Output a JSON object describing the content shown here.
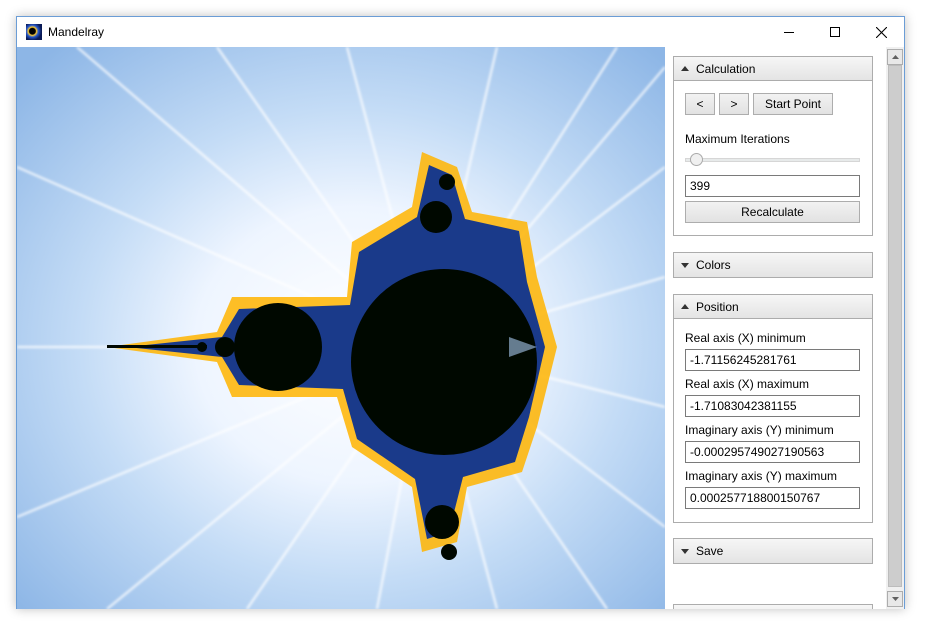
{
  "window": {
    "title": "Mandelray"
  },
  "calculation": {
    "header": "Calculation",
    "prev_label": "<",
    "next_label": ">",
    "start_point_label": "Start Point",
    "max_iterations_label": "Maximum Iterations",
    "max_iterations_value": "399",
    "recalculate_label": "Recalculate"
  },
  "colors": {
    "header": "Colors"
  },
  "position": {
    "header": "Position",
    "x_min_label": "Real axis (X) minimum",
    "x_min_value": "-1.71156245281761",
    "x_max_label": "Real axis (X) maximum",
    "x_max_value": "-1.71083042381155",
    "y_min_label": "Imaginary axis (Y) minimum",
    "y_min_value": "-0.000295749027190563",
    "y_max_label": "Imaginary axis (Y) maximum",
    "y_max_value": "0.000257718800150767"
  },
  "save": {
    "header": "Save"
  },
  "icons": {
    "app": "mandelbrot-app-icon",
    "minimize": "minimize-icon",
    "maximize": "maximize-icon",
    "close": "close-icon",
    "expanded": "chevron-up-icon",
    "collapsed": "chevron-down-icon"
  },
  "colors_palette": {
    "accent_border": "#6b9dd6",
    "fractal_body": "#000800",
    "fractal_bg": "#a9c9ee"
  }
}
